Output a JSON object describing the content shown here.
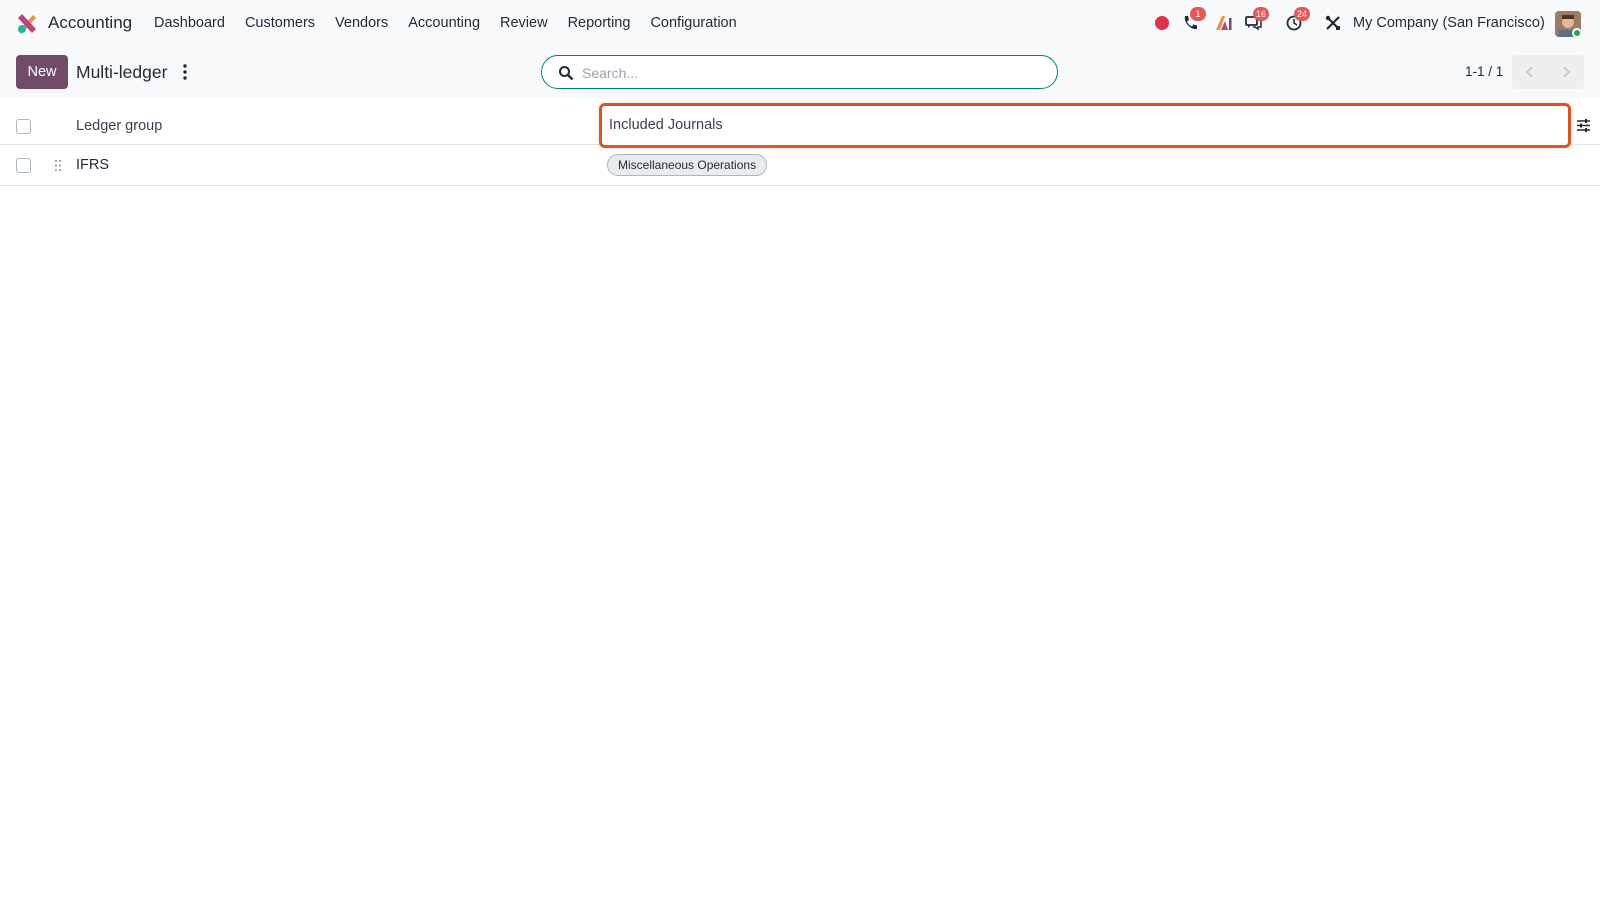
{
  "navbar": {
    "app_name": "Accounting",
    "menu": [
      "Dashboard",
      "Customers",
      "Vendors",
      "Accounting",
      "Review",
      "Reporting",
      "Configuration"
    ],
    "systray": {
      "record_icon": "record-dot-icon",
      "phone_badge": "1",
      "messages_badge": "16",
      "activities_badge": "24",
      "company": "My Company (San Francisco)"
    }
  },
  "control_panel": {
    "new_label": "New",
    "breadcrumb": "Multi-ledger",
    "search_placeholder": "Search...",
    "pager": "1-1 / 1"
  },
  "list": {
    "columns": [
      "Ledger group",
      "Included Journals"
    ],
    "rows": [
      {
        "name": "IFRS",
        "journals": [
          "Miscellaneous Operations"
        ]
      }
    ]
  },
  "colors": {
    "brand": "#714b67",
    "highlight": "#d4572a",
    "search_border": "#017e84",
    "badge": "#e45858"
  }
}
